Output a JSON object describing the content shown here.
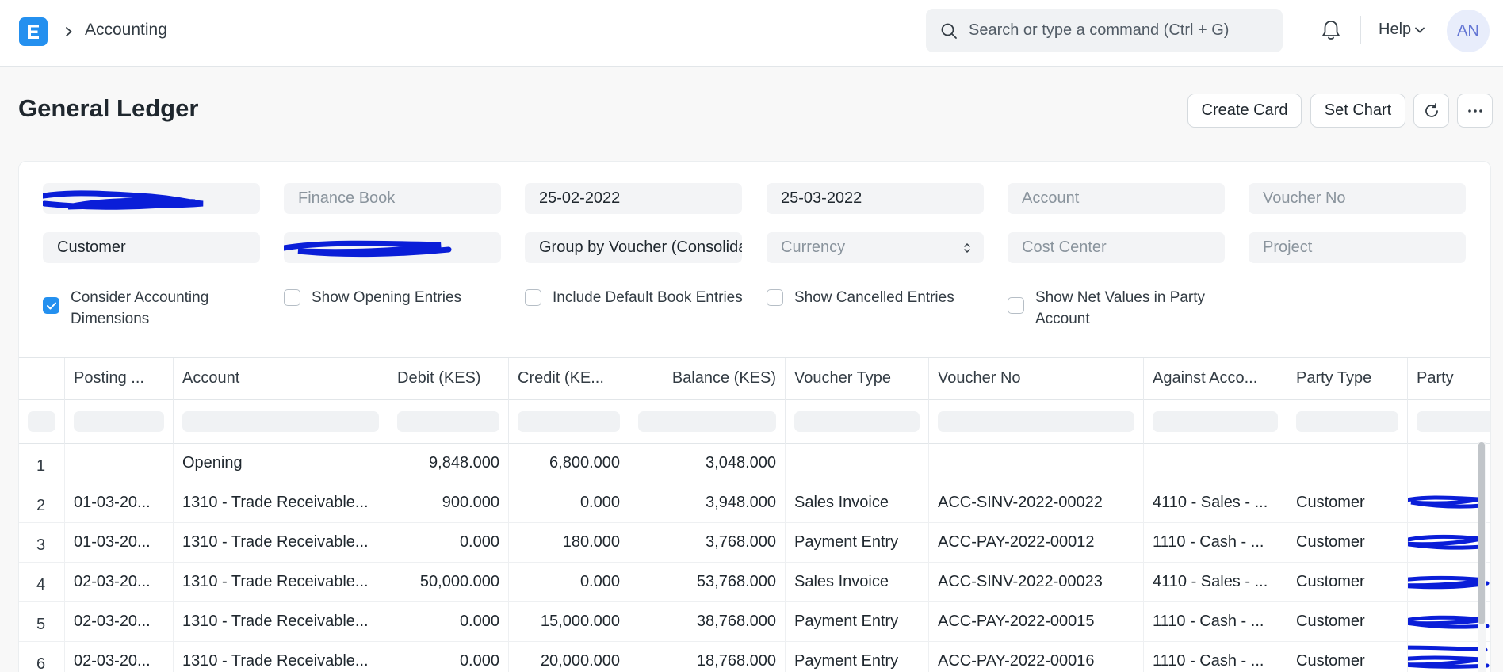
{
  "nav": {
    "breadcrumb": "Accounting",
    "search_placeholder": "Search or type a command (Ctrl + G)",
    "help_label": "Help",
    "avatar_initials": "AN"
  },
  "page": {
    "title": "General Ledger",
    "buttons": {
      "create_card": "Create Card",
      "set_chart": "Set Chart"
    }
  },
  "filters": {
    "finance_book": "Finance Book",
    "from_date": "25-02-2022",
    "to_date": "25-03-2022",
    "account": "Account",
    "voucher_no": "Voucher No",
    "party_type": "Customer",
    "group_by": "Group by Voucher (Consolidated)",
    "currency": "Currency",
    "cost_center": "Cost Center",
    "project": "Project"
  },
  "checkboxes": [
    {
      "label": "Consider Accounting Dimensions",
      "checked": true
    },
    {
      "label": "Show Opening Entries",
      "checked": false
    },
    {
      "label": "Include Default Book Entries",
      "checked": false
    },
    {
      "label": "Show Cancelled Entries",
      "checked": false
    },
    {
      "label": "Show Net Values in Party Account",
      "checked": false
    }
  ],
  "table": {
    "headers": [
      "Posting ...",
      "Account",
      "Debit (KES)",
      "Credit (KE...",
      "Balance (KES)",
      "Voucher Type",
      "Voucher No",
      "Against Acco...",
      "Party Type",
      "Party"
    ],
    "rows": [
      [
        "1",
        "",
        "Opening",
        "9,848.000",
        "6,800.000",
        "3,048.000",
        "",
        "",
        "",
        ""
      ],
      [
        "2",
        "01-03-20...",
        "1310 - Trade Receivable...",
        "900.000",
        "0.000",
        "3,948.000",
        "Sales Invoice",
        "ACC-SINV-2022-00022",
        "4110 - Sales - ...",
        "Customer"
      ],
      [
        "3",
        "01-03-20...",
        "1310 - Trade Receivable...",
        "0.000",
        "180.000",
        "3,768.000",
        "Payment Entry",
        "ACC-PAY-2022-00012",
        "1110 - Cash - ...",
        "Customer"
      ],
      [
        "4",
        "02-03-20...",
        "1310 - Trade Receivable...",
        "50,000.000",
        "0.000",
        "53,768.000",
        "Sales Invoice",
        "ACC-SINV-2022-00023",
        "4110 - Sales - ...",
        "Customer"
      ],
      [
        "5",
        "02-03-20...",
        "1310 - Trade Receivable...",
        "0.000",
        "15,000.000",
        "38,768.000",
        "Payment Entry",
        "ACC-PAY-2022-00015",
        "1110 - Cash - ...",
        "Customer"
      ],
      [
        "6",
        "02-03-20...",
        "1310 - Trade Receivable...",
        "0.000",
        "20,000.000",
        "18,768.000",
        "Payment Entry",
        "ACC-PAY-2022-00016",
        "1110 - Cash - ...",
        "Customer"
      ]
    ]
  },
  "colors": {
    "accent": "#2490ef",
    "redaction": "#0a1ed8"
  }
}
